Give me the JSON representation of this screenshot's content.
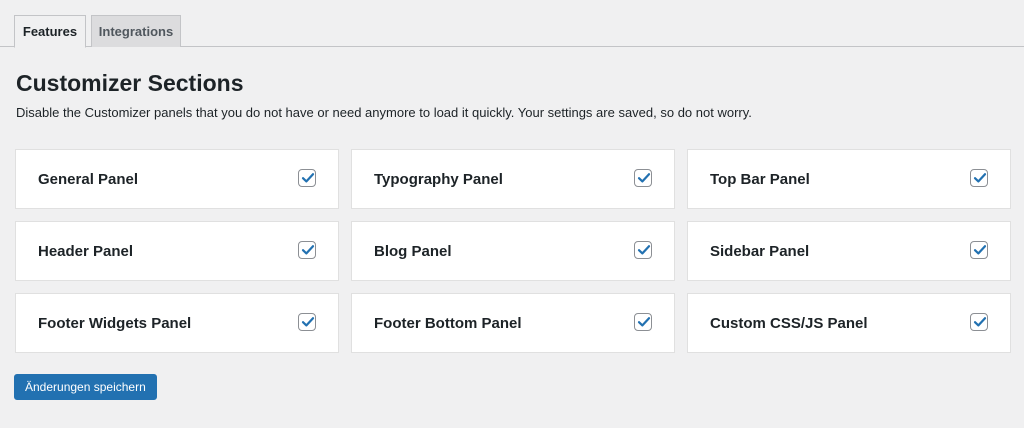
{
  "tabs": [
    {
      "label": "Features",
      "active": true
    },
    {
      "label": "Integrations",
      "active": false
    }
  ],
  "section": {
    "title": "Customizer Sections",
    "description": "Disable the Customizer panels that you do not have or need anymore to load it quickly. Your settings are saved, so do not worry."
  },
  "panels": [
    {
      "label": "General Panel",
      "checked": true
    },
    {
      "label": "Typography Panel",
      "checked": true
    },
    {
      "label": "Top Bar Panel",
      "checked": true
    },
    {
      "label": "Header Panel",
      "checked": true
    },
    {
      "label": "Blog Panel",
      "checked": true
    },
    {
      "label": "Sidebar Panel",
      "checked": true
    },
    {
      "label": "Footer Widgets Panel",
      "checked": true
    },
    {
      "label": "Footer Bottom Panel",
      "checked": true
    },
    {
      "label": "Custom CSS/JS Panel",
      "checked": true
    }
  ],
  "save_button": {
    "label": "Änderungen speichern"
  },
  "colors": {
    "accent": "#2271b1",
    "background": "#f0f0f1",
    "card": "#ffffff"
  }
}
